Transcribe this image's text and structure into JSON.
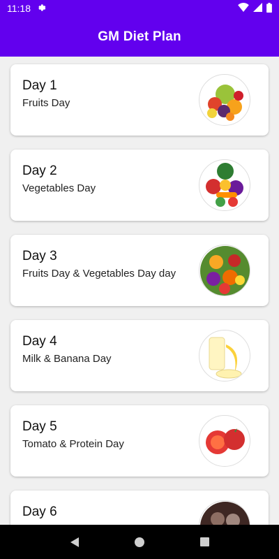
{
  "status": {
    "time": "11:18"
  },
  "app_bar": {
    "title": "GM Diet Plan"
  },
  "days": [
    {
      "title": "Day 1",
      "subtitle": "Fruits Day",
      "image": "fruits-image"
    },
    {
      "title": "Day 2",
      "subtitle": "Vegetables Day",
      "image": "vegetables-image"
    },
    {
      "title": "Day 3",
      "subtitle": "Fruits Day & Vegetables Day day",
      "image": "fruits-vegetables-image"
    },
    {
      "title": "Day 4",
      "subtitle": "Milk & Banana Day",
      "image": "milk-banana-image"
    },
    {
      "title": "Day 5",
      "subtitle": "Tomato & Protein Day",
      "image": "tomato-image"
    },
    {
      "title": "Day 6",
      "subtitle": "",
      "image": "protein-image"
    }
  ],
  "colors": {
    "primary": "#6200ee",
    "background": "#f0f0f0",
    "card": "#ffffff"
  }
}
